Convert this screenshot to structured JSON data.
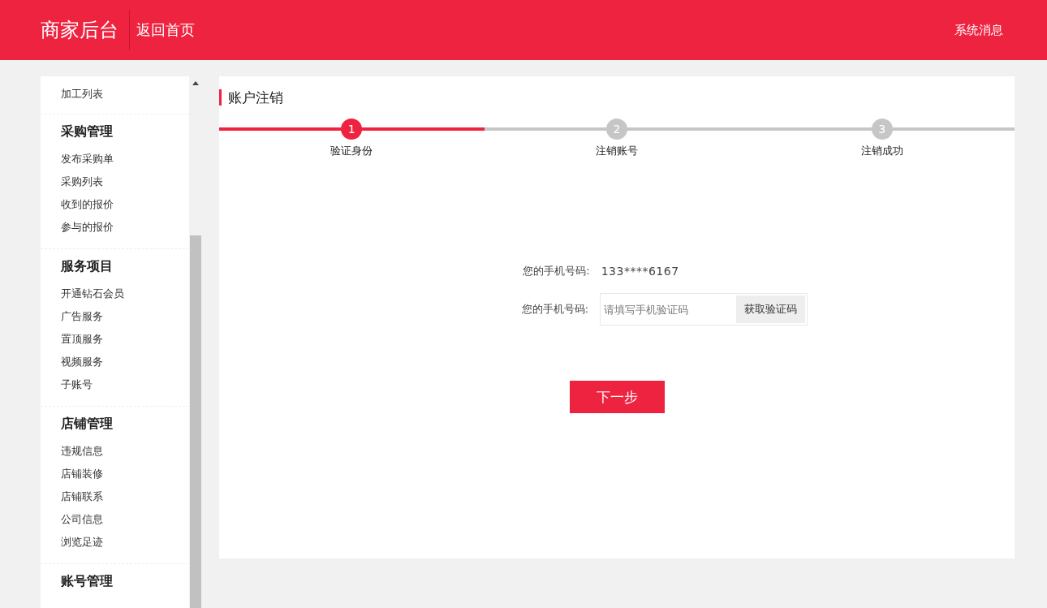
{
  "header": {
    "brand": "商家后台",
    "home_link": "返回首页",
    "messages_link": "系统消息"
  },
  "sidebar": {
    "groups": [
      {
        "items": [
          "加工列表"
        ]
      },
      {
        "heading": "采购管理",
        "items": [
          "发布采购单",
          "采购列表",
          "收到的报价",
          "参与的报价"
        ]
      },
      {
        "heading": "服务项目",
        "items": [
          "开通钻石会员",
          "广告服务",
          "置顶服务",
          "视频服务",
          "子账号"
        ]
      },
      {
        "heading": "店铺管理",
        "items": [
          "违规信息",
          "店铺装修",
          "店铺联系",
          "公司信息",
          "浏览足迹"
        ]
      },
      {
        "heading": "账号管理"
      }
    ]
  },
  "panel": {
    "title": "账户注销",
    "steps": [
      {
        "number": "1",
        "label": "验证身份",
        "selected": true
      },
      {
        "number": "2",
        "label": "注销账号",
        "selected": false
      },
      {
        "number": "3",
        "label": "注销成功",
        "selected": false
      }
    ],
    "phone_label": "您的手机号码:",
    "phone_value": "133****6167",
    "code_label": "您的手机号码:",
    "code_placeholder": "请填写手机验证码",
    "code_button": "获取验证码",
    "next_button": "下一步"
  }
}
